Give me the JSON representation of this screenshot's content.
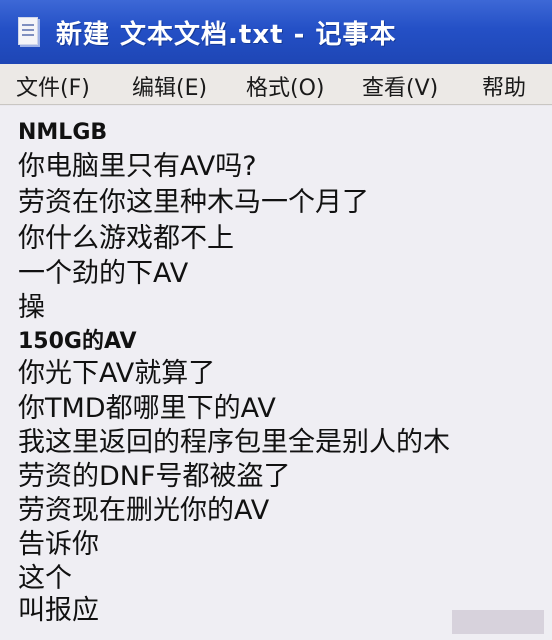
{
  "window": {
    "title": "新建 文本文档.txt - 记事本",
    "icon": "notepad-icon"
  },
  "menu": {
    "items": [
      "文件(F)",
      "编辑(E)",
      "格式(O)",
      "查看(V)",
      "帮助"
    ]
  },
  "document": {
    "lines": [
      "NMLGB",
      "你电脑里只有AV吗?",
      "劳资在你这里种木马一个月了",
      "你什么游戏都不上",
      "一个劲的下AV",
      "操",
      "150G的AV",
      "你光下AV就算了",
      "你TMD都哪里下的AV",
      "我这里返回的程序包里全是别人的木",
      "劳资的DNF号都被盗了",
      "劳资现在删光你的AV",
      "告诉你",
      "这个",
      "叫报应"
    ]
  },
  "colors": {
    "titlebar": "#2450c6",
    "menubar": "#ece9e6",
    "page": "#efeef3",
    "text": "#111111"
  }
}
